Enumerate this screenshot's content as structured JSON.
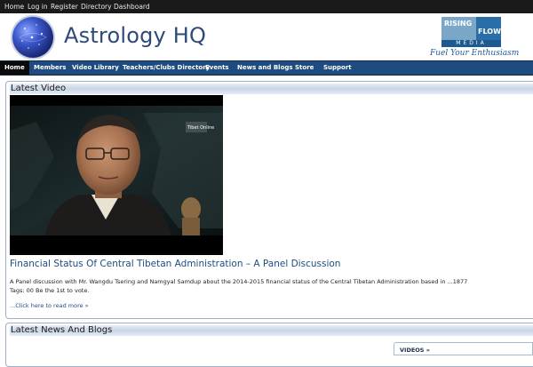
{
  "topbar": {
    "links": [
      "Home",
      "Log in",
      "Register",
      "Directory Dashboard"
    ]
  },
  "header": {
    "site_title": "Astrology HQ",
    "ad": {
      "word1": "RISING",
      "word2": "FLOW",
      "word3": "MEDIA",
      "slogan": "Fuel Your Enthusiasm"
    }
  },
  "nav": {
    "items": [
      "Home",
      "Members",
      "Video Library",
      "Teachers/Clubs Directory",
      "Events",
      "News and Blogs",
      "Store",
      "Support"
    ],
    "active": "Home"
  },
  "latest_video": {
    "heading": "Latest Video",
    "title": "Financial Status Of Central Tibetan Administration – A Panel Discussion",
    "description": "A Panel discussion with Mr. Wangdu Tsering and Namgyal Samdup about the 2014-2015 financial status of the Central Tibetan Administration based in ...1877",
    "tags_line": "Tags:   00    Be the 1st to vote.",
    "read_more": "...Click here to read more »",
    "watermark": "Tibet Online"
  },
  "latest_news": {
    "heading": "Latest News And Blogs",
    "sidebar_box_label": "VIDEOS »"
  }
}
